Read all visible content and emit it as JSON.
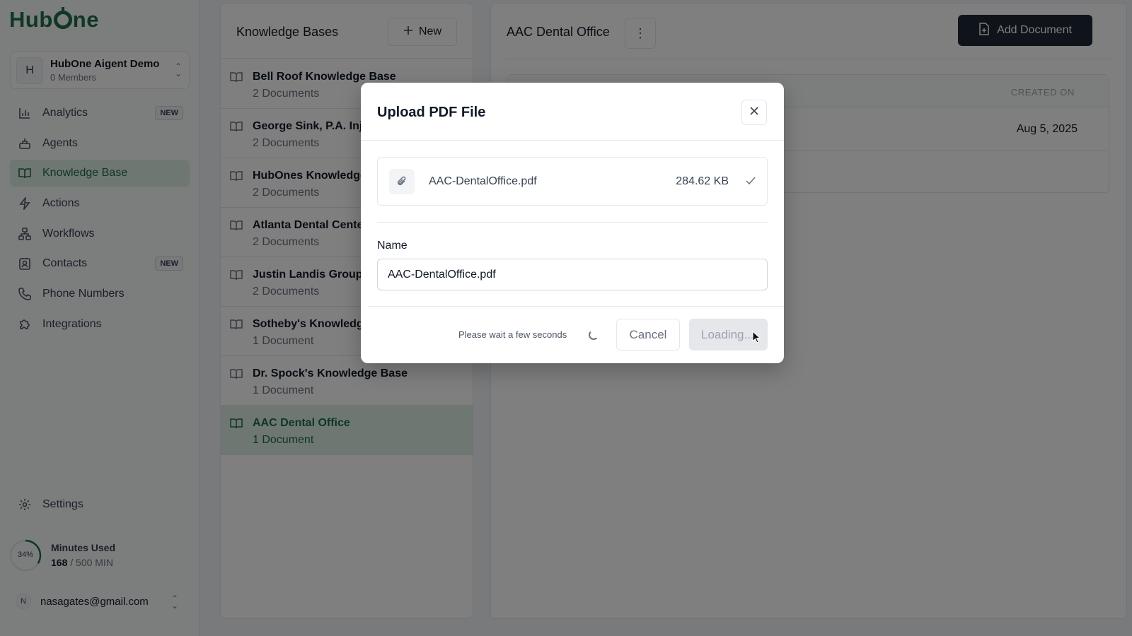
{
  "brand": {
    "logo_text_1": "Hub",
    "logo_text_2": "ne",
    "accent": "#1f6f4a"
  },
  "workspace": {
    "initial": "H",
    "name": "HubOne Aigent Demo",
    "members": "0 Members"
  },
  "sidebar": {
    "items": [
      {
        "label": "Analytics",
        "icon": "bar-chart-icon",
        "badge": "NEW",
        "active": false
      },
      {
        "label": "Agents",
        "icon": "agent-icon",
        "badge": "",
        "active": false
      },
      {
        "label": "Knowledge Base",
        "icon": "book-icon",
        "badge": "",
        "active": true
      },
      {
        "label": "Actions",
        "icon": "bolt-icon",
        "badge": "",
        "active": false
      },
      {
        "label": "Workflows",
        "icon": "workflow-icon",
        "badge": "",
        "active": false
      },
      {
        "label": "Contacts",
        "icon": "contacts-icon",
        "badge": "NEW",
        "active": false
      },
      {
        "label": "Phone Numbers",
        "icon": "phone-icon",
        "badge": "",
        "active": false
      },
      {
        "label": "Integrations",
        "icon": "puzzle-icon",
        "badge": "",
        "active": false
      }
    ],
    "settings_label": "Settings"
  },
  "usage": {
    "percent_label": "34%",
    "percent": 0.34,
    "title": "Minutes Used",
    "used": "168",
    "limit": "/ 500 MIN"
  },
  "user": {
    "initial": "N",
    "email": "nasagates@gmail.com"
  },
  "kb_panel": {
    "title": "Knowledge Bases",
    "new_label": "New",
    "items": [
      {
        "name": "Bell Roof Knowledge Base",
        "count": "2 Documents"
      },
      {
        "name": "George Sink, P.A. Inj",
        "count": "2 Documents"
      },
      {
        "name": "HubOnes Knowledge",
        "count": "2 Documents"
      },
      {
        "name": "Atlanta Dental Cente",
        "count": "2 Documents"
      },
      {
        "name": "Justin Landis Group",
        "count": "2 Documents"
      },
      {
        "name": "Sotheby's Knowledg",
        "count": "1 Document"
      },
      {
        "name": "Dr. Spock's Knowledge Base",
        "count": "1 Document"
      },
      {
        "name": "AAC Dental Office",
        "count": "1 Document"
      }
    ]
  },
  "detail": {
    "title": "AAC Dental Office",
    "add_document_label": "Add Document",
    "table": {
      "created_on_header": "CREATED ON",
      "rows": [
        {
          "created_on": "Aug 5, 2025"
        }
      ]
    }
  },
  "modal": {
    "title": "Upload PDF File",
    "file": {
      "name": "AAC-DentalOffice.pdf",
      "size": "284.62 KB"
    },
    "name_label": "Name",
    "name_value": "AAC-DentalOffice.pdf",
    "wait_text": "Please wait a few seconds",
    "cancel_label": "Cancel",
    "loading_label": "Loading..."
  }
}
